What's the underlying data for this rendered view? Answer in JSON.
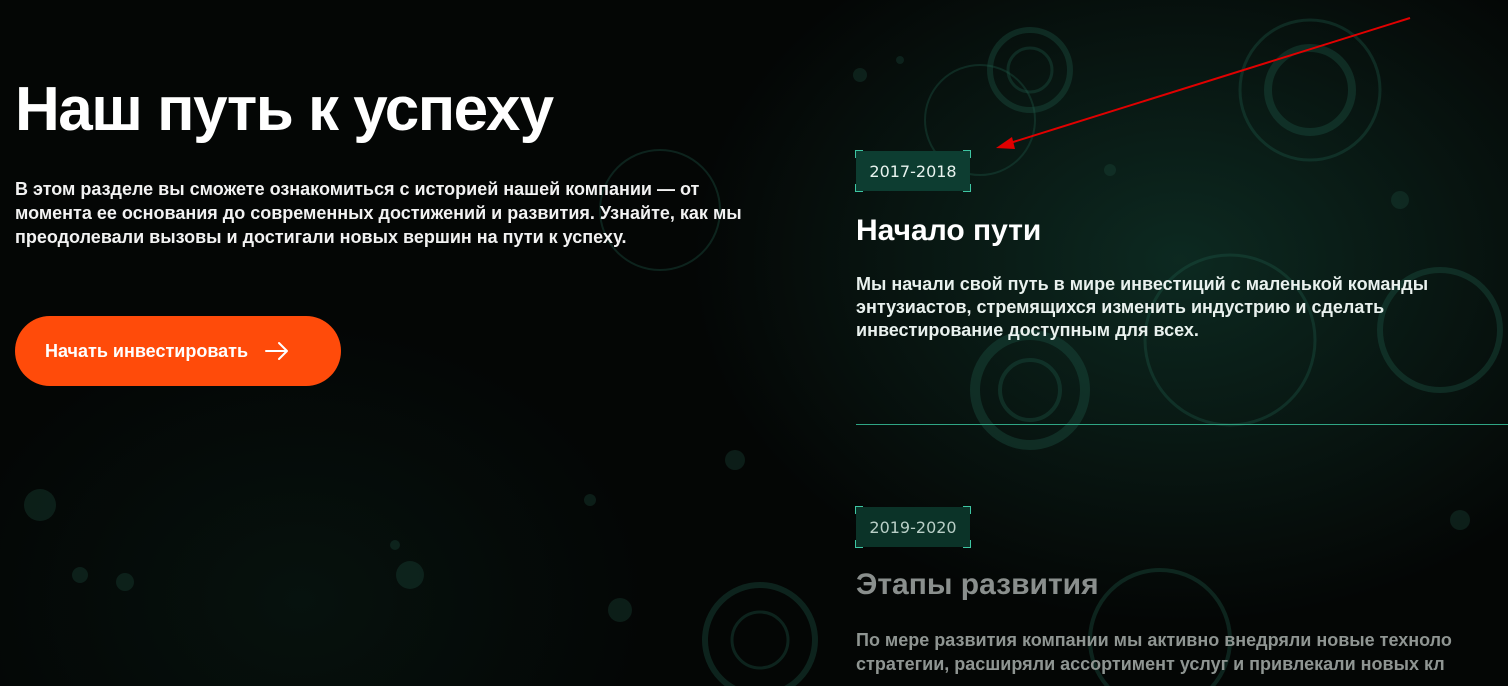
{
  "hero": {
    "title": "Наш путь к успеху",
    "intro": "В этом разделе вы сможете ознакомиться с историей нашей компании — от момента ее основания до современных достижений и развития. Узнайте, как мы преодолевали вызовы и достигали новых вершин на пути к успеху.",
    "cta_label": "Начать инвестировать",
    "cta_icon": "arrow-right-icon"
  },
  "timeline": {
    "items": [
      {
        "year": "2017-2018",
        "title": "Начало пути",
        "text": "Мы начали свой путь в мире инвестиций с маленькой команды\nэнтузиастов, стремящихся изменить индустрию и сделать\nинвестирование доступным для всех."
      },
      {
        "year": "2019-2020",
        "title": "Этапы развития",
        "text_line1": "По мере развития компании мы активно внедряли новые техноло",
        "text_line2": "стратегии, расширяли ассортимент услуг и привлекали новых кл"
      }
    ]
  },
  "colors": {
    "accent": "#ff4b0a",
    "badge_bg": "#0d3d31",
    "badge_corner": "#3ec6a3",
    "divider": "#2fa584",
    "annotation_arrow": "#e00000"
  }
}
